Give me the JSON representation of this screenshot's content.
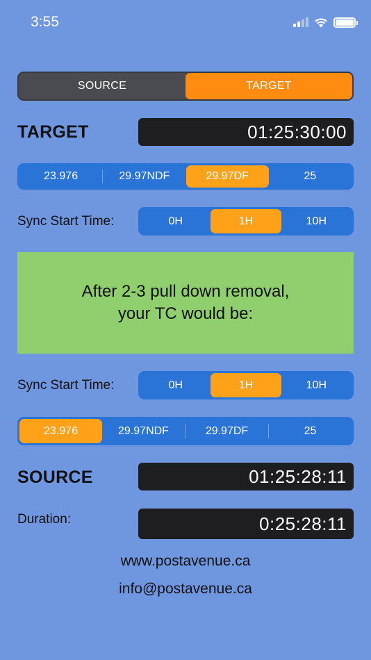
{
  "status_bar": {
    "time": "3:55"
  },
  "mode_toggle": {
    "source_label": "SOURCE",
    "target_label": "TARGET",
    "selected": "TARGET"
  },
  "target": {
    "title": "TARGET",
    "timecode": "01:25:30:00",
    "frame_rates": [
      "23.976",
      "29.97NDF",
      "29.97DF",
      "25"
    ],
    "frame_rate_selected": "29.97DF",
    "sync_label": "Sync Start Time:",
    "sync_options": [
      "0H",
      "1H",
      "10H"
    ],
    "sync_selected": "1H"
  },
  "result": {
    "line1": "After 2-3 pull down removal,",
    "line2": "your TC would be:"
  },
  "source": {
    "sync_label": "Sync Start Time:",
    "sync_options": [
      "0H",
      "1H",
      "10H"
    ],
    "sync_selected": "1H",
    "frame_rates": [
      "23.976",
      "29.97NDF",
      "29.97DF",
      "25"
    ],
    "frame_rate_selected": "23.976",
    "title": "SOURCE",
    "timecode": "01:25:28:11",
    "duration_label": "Duration:",
    "duration": "0:25:28:11"
  },
  "footer": {
    "website": "www.postavenue.ca",
    "email": "info@postavenue.ca"
  },
  "colors": {
    "background": "#6f97df",
    "accent_orange": "#ff8c10",
    "segment_blue": "#2a74d8",
    "result_green": "#8fcf6e",
    "timecode_bg": "#1e1e20"
  }
}
